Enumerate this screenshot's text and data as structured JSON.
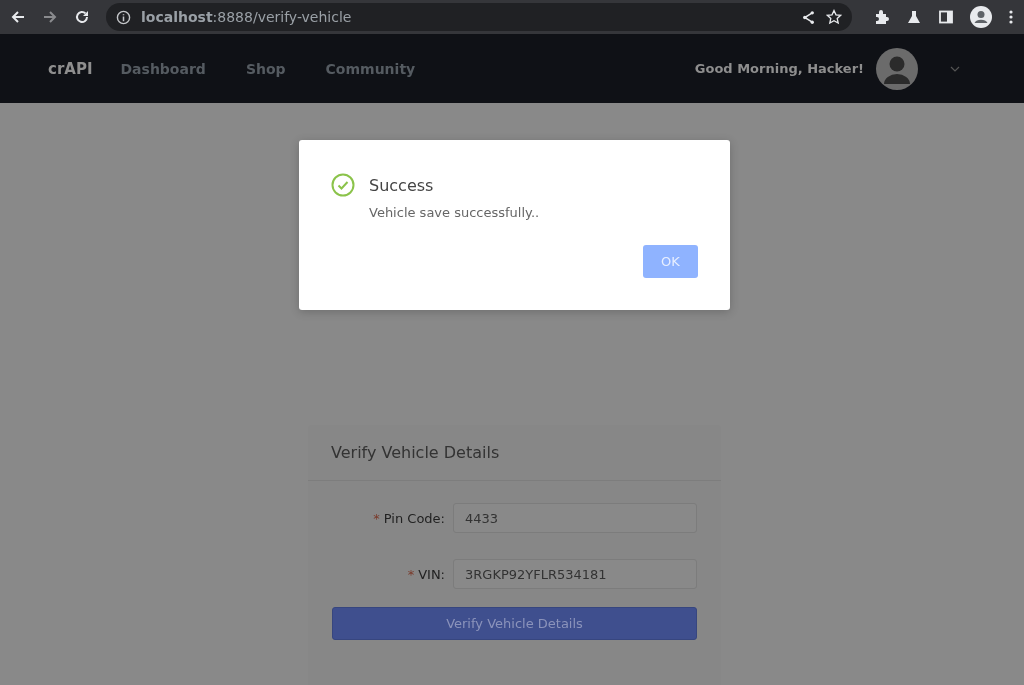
{
  "browser": {
    "url": "**localhost**:8888/verify-vehicle"
  },
  "navbar": {
    "brand": "crAPI",
    "links": [
      {
        "label": "Dashboard"
      },
      {
        "label": "Shop"
      },
      {
        "label": "Community"
      }
    ],
    "greeting": "Good Morning, Hacker!"
  },
  "form": {
    "title": "Verify Vehicle Details",
    "fields": [
      {
        "required_mark": "*",
        "label": "Pin Code:",
        "value": "4433"
      },
      {
        "required_mark": "*",
        "label": "VIN:",
        "value": "3RGKP92YFLR534181"
      }
    ],
    "submit": "Verify Vehicle Details"
  },
  "dialog": {
    "kind": "success",
    "title": "Success",
    "message": "Vehicle save successfully..",
    "button": "OK"
  }
}
